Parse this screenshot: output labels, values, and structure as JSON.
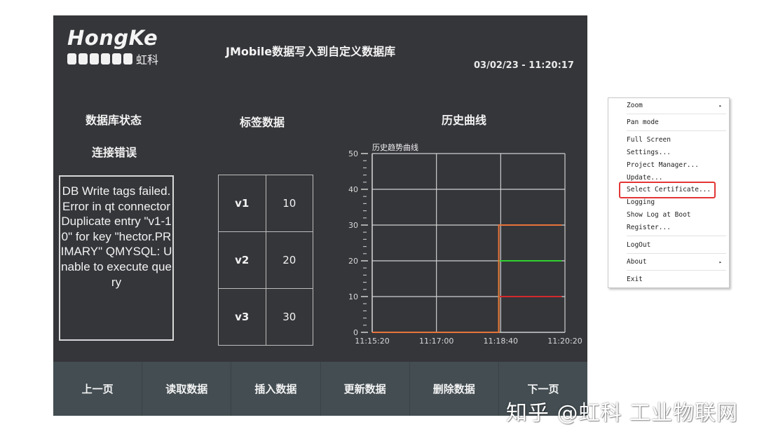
{
  "header": {
    "logo_text": "HongKe",
    "logo_cn": "虹科",
    "title": "JMobile数据写入到自定义数据库",
    "datetime": "03/02/23 - 11:20:17"
  },
  "db_status": {
    "title": "数据库状态",
    "state": "连接错误",
    "message": "DB Write tags failed.\nError in qt connectorDuplicate entry \"v1-10\" for key \"hector.PRIMARY\" QMYSQL: Unable to execute query"
  },
  "tag_data": {
    "title": "标签数据",
    "rows": [
      {
        "name": "v1",
        "value": "10"
      },
      {
        "name": "v2",
        "value": "20"
      },
      {
        "name": "v3",
        "value": "30"
      }
    ]
  },
  "history": {
    "title": "历史曲线"
  },
  "chart_data": {
    "type": "line",
    "title": "历史趋势曲线",
    "xlabel": "",
    "ylabel": "",
    "x_ticks": [
      "11:15:20",
      "11:17:00",
      "11:18:40",
      "11:20:20"
    ],
    "x_range_seconds": [
      0,
      300
    ],
    "y_ticks": [
      0,
      10,
      20,
      30,
      40,
      50
    ],
    "ylim": [
      0,
      50
    ],
    "grid": true,
    "series": [
      {
        "name": "v1",
        "color": "#d42a2a",
        "points": [
          [
            0,
            0
          ],
          [
            197,
            0
          ],
          [
            197,
            10
          ],
          [
            295,
            10
          ]
        ]
      },
      {
        "name": "v2",
        "color": "#2fd12f",
        "points": [
          [
            0,
            0
          ],
          [
            197,
            0
          ],
          [
            197,
            20
          ],
          [
            295,
            20
          ]
        ]
      },
      {
        "name": "v3",
        "color": "#e8743a",
        "points": [
          [
            0,
            0
          ],
          [
            197,
            0
          ],
          [
            197,
            30
          ],
          [
            295,
            30
          ]
        ]
      }
    ]
  },
  "buttons": [
    "上一页",
    "读取数据",
    "插入数据",
    "更新数据",
    "删除数据",
    "下一页"
  ],
  "context_menu": {
    "items": [
      {
        "label": "Zoom",
        "submenu": true
      },
      {
        "label": "Pan mode"
      },
      {
        "label": "Full Screen"
      },
      {
        "label": "Settings..."
      },
      {
        "label": "Project Manager..."
      },
      {
        "label": "Update..."
      },
      {
        "label": "Select Certificate...",
        "highlighted": true
      },
      {
        "label": "Logging"
      },
      {
        "label": "Show Log at Boot"
      },
      {
        "label": "Register..."
      },
      {
        "label": "LogOut"
      },
      {
        "label": "About",
        "submenu": true
      },
      {
        "label": "Exit"
      }
    ],
    "submenu_arrow": "▸",
    "highlight_color": "#e23636"
  },
  "watermark": "知乎 @虹科 工业物联网"
}
